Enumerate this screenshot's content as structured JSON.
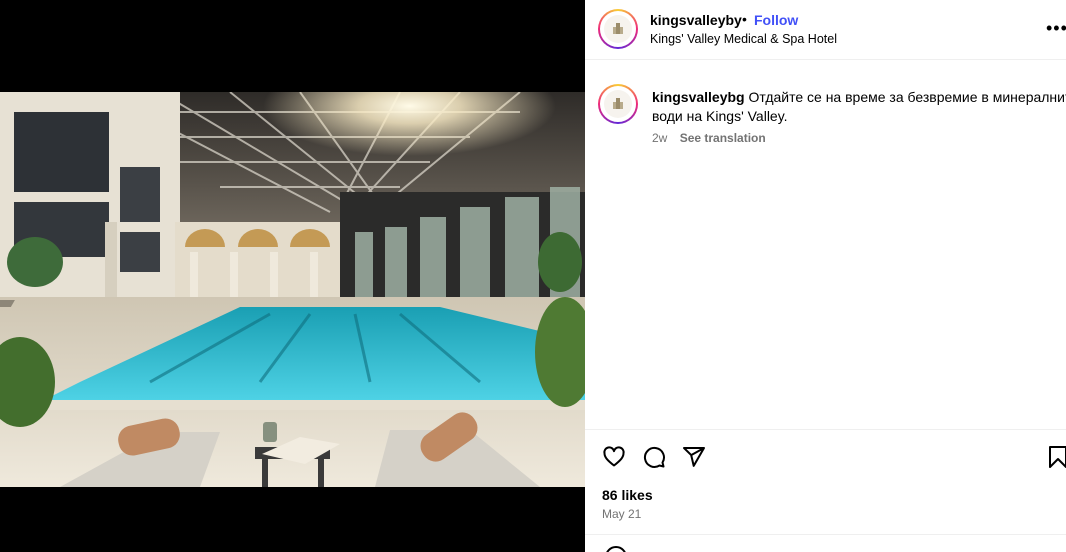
{
  "post": {
    "image_alt": "Indoor pool with glass roof, sun loungers and towels",
    "username": "kingsvalleyby",
    "separator": "•",
    "follow_label": "Follow",
    "location": "Kings' Valley Medical & Spa Hotel",
    "more_label": "•••"
  },
  "caption": {
    "username": "kingsvalleybg",
    "text_line1": "Отдайте се на време за безвремие в минералните",
    "text_line2": "води на Kings' Valley.",
    "age": "2w",
    "see_translation": "See translation"
  },
  "engagement": {
    "likes": "86 likes",
    "date": "May 21"
  },
  "icons": [
    "heart-icon",
    "comment-icon",
    "share-icon",
    "bookmark-icon",
    "more-icon"
  ],
  "colors": {
    "follow": "#4150f7",
    "muted": "#737373",
    "pool": "#3fc6d9"
  }
}
